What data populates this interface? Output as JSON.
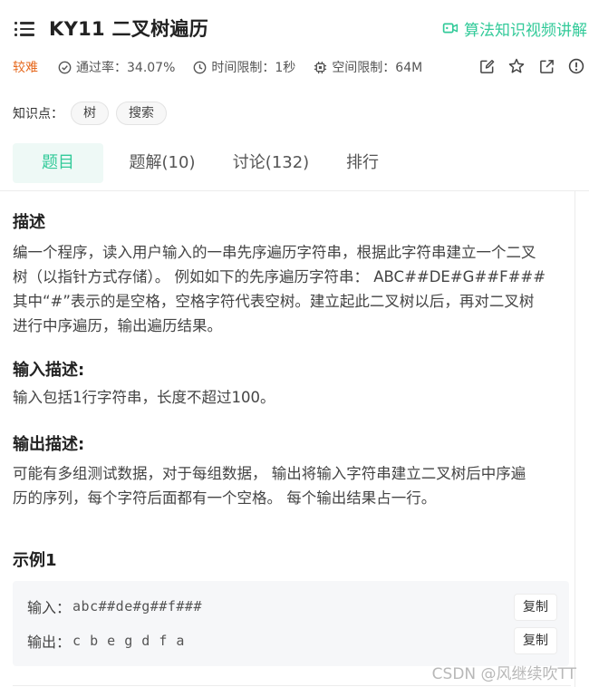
{
  "header": {
    "title": "KY11  二叉树遍历",
    "video_link": "算法知识视频讲解"
  },
  "meta": {
    "difficulty": "较难",
    "pass_rate": "通过率：34.07%",
    "time_limit": "时间限制：1秒",
    "space_limit": "空间限制：64M"
  },
  "tags": {
    "label": "知识点：",
    "items": [
      "树",
      "搜索"
    ]
  },
  "tabs": [
    {
      "label": "题目"
    },
    {
      "label": "题解(10)"
    },
    {
      "label": "讨论(132)"
    },
    {
      "label": "排行"
    }
  ],
  "description": {
    "heading": "描述",
    "line1": "编一个程序，读入用户输入的一串先序遍历字符串，根据此字符串建立一个二叉",
    "line2": "树（以指针方式存储）。 例如如下的先序遍历字符串： ABC##DE#G##F###",
    "line3": "其中“#”表示的是空格，空格字符代表空树。建立起此二叉树以后，再对二叉树",
    "line4": "进行中序遍历，输出遍历结果。"
  },
  "input_desc": {
    "heading": "输入描述:",
    "text": "输入包括1行字符串，长度不超过100。"
  },
  "output_desc": {
    "heading": "输出描述:",
    "line1": "可能有多组测试数据，对于每组数据， 输出将输入字符串建立二叉树后中序遍",
    "line2": "历的序列，每个字符后面都有一个空格。 每个输出结果占一行。"
  },
  "example": {
    "heading": "示例1",
    "input_label": "输入：",
    "input_value": "abc##de#g##f###",
    "output_label": "输出：",
    "output_value": "c b e g d f a",
    "copy_label": "复制"
  },
  "watermark": "CSDN @风继续吹TT",
  "colors": {
    "accent": "#32ca99",
    "difficulty": "#e6691e"
  }
}
